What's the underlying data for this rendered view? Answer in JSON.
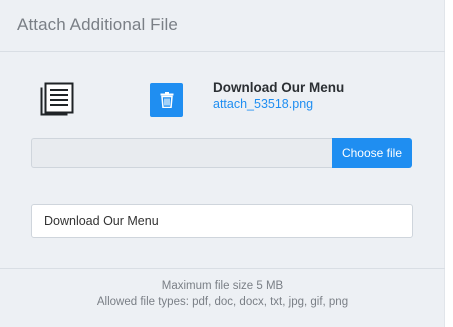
{
  "header": {
    "title": "Attach Additional File"
  },
  "attachment": {
    "icon": "document-lines-icon",
    "delete_icon": "trash-icon",
    "title": "Download Our Menu",
    "filename": "attach_53518.png"
  },
  "file_picker": {
    "path_value": "",
    "choose_label": "Choose file"
  },
  "title_field": {
    "value": "Download Our Menu"
  },
  "footer": {
    "max_size": "Maximum file size 5 MB",
    "allowed_types": "Allowed file types: pdf, doc, docx, txt, jpg, gif, png"
  },
  "colors": {
    "accent": "#1f8ef1",
    "panel_bg": "#edf0f4",
    "muted_text": "#7a7f86"
  }
}
